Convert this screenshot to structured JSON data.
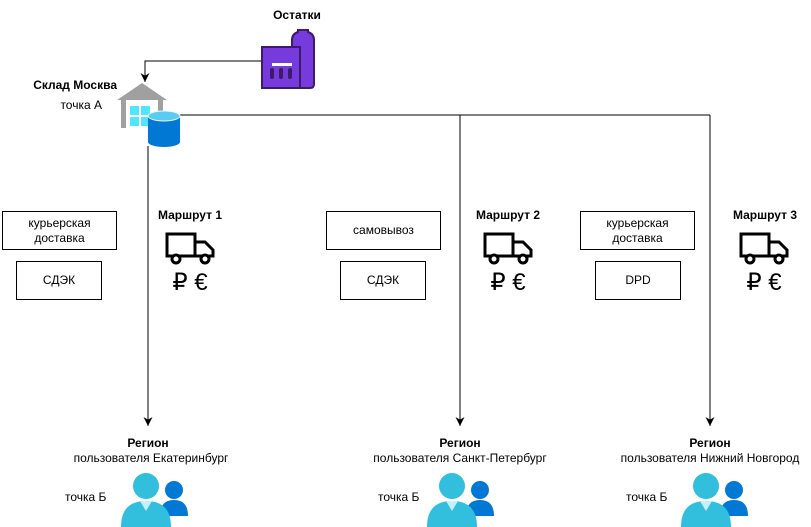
{
  "stock": {
    "label": "Остатки"
  },
  "warehouse": {
    "name": "Склад Москва",
    "point": "точка А"
  },
  "routes": [
    {
      "title": "Маршрут 1",
      "currency": "₽ €",
      "delivery": "курьерская доставка",
      "carrier": "СДЭК",
      "region_title": "Регион",
      "region_name": "пользователя Екатеринбург",
      "point": "точка Б"
    },
    {
      "title": "Маршрут 2",
      "currency": "₽ €",
      "delivery": "самовывоз",
      "carrier": "СДЭК",
      "region_title": "Регион",
      "region_name": "пользователя Санкт-Петербург",
      "point": "точка Б"
    },
    {
      "title": "Маршрут 3",
      "currency": "₽ €",
      "delivery": "курьерская доставка",
      "carrier": "DPD",
      "region_title": "Регион",
      "region_name": "пользователя Нижний Новгород",
      "point": "точка Б"
    }
  ],
  "colors": {
    "stock_icon": "#773adc",
    "warehouse": "#a0a0a0",
    "database": "#0078d4",
    "user": "#32bedd"
  }
}
